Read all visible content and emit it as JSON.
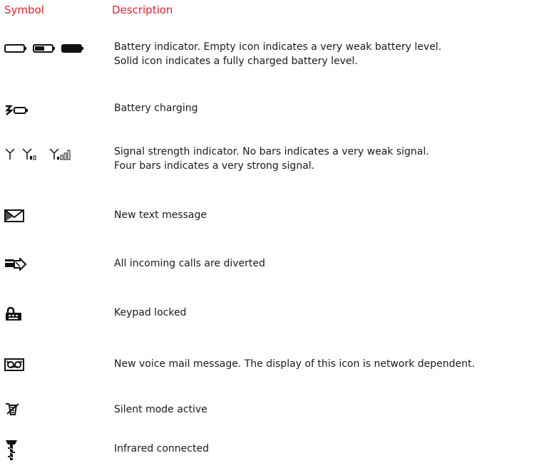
{
  "header": {
    "symbol_label": "Symbol",
    "description_label": "Description"
  },
  "accent_color": "#e8202a",
  "rows": [
    {
      "icon": "battery-icons",
      "lines": [
        "Battery indicator. Empty icon indicates a very weak battery level.",
        "Solid icon indicates a fully charged battery level."
      ]
    },
    {
      "icon": "battery-charging-icon",
      "lines": [
        "Battery charging"
      ]
    },
    {
      "icon": "signal-strength-icons",
      "lines": [
        "Signal strength indicator. No bars indicates a very weak signal.",
        "Four bars indicates a very strong signal."
      ]
    },
    {
      "icon": "envelope-icon",
      "lines": [
        "New text message"
      ]
    },
    {
      "icon": "call-divert-icon",
      "lines": [
        "All incoming calls are diverted"
      ]
    },
    {
      "icon": "keypad-lock-icon",
      "lines": [
        "Keypad  locked"
      ]
    },
    {
      "icon": "voicemail-icon",
      "lines": [
        "New voice mail message. The display of this icon is network dependent."
      ]
    },
    {
      "icon": "silent-mode-icon",
      "lines": [
        "Silent mode active"
      ]
    },
    {
      "icon": "infrared-icon",
      "lines": [
        "Infrared connected"
      ]
    }
  ]
}
